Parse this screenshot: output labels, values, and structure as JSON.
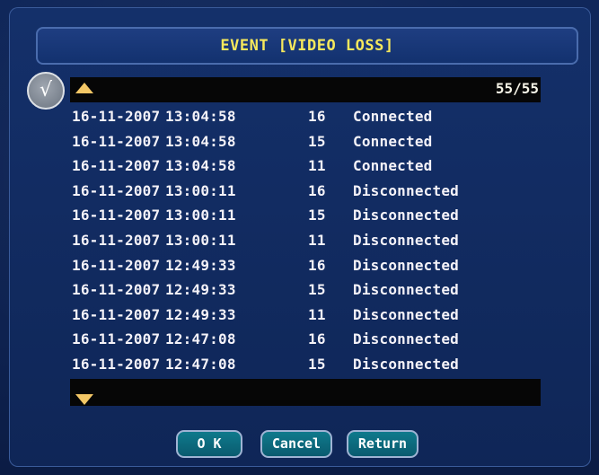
{
  "header": {
    "title": "EVENT [VIDEO LOSS]",
    "page_counter": "55/55",
    "check_mark": "√"
  },
  "events": [
    {
      "date": "16-11-2007",
      "time": "13:04:58",
      "channel": "16",
      "status": "Connected"
    },
    {
      "date": "16-11-2007",
      "time": "13:04:58",
      "channel": "15",
      "status": "Connected"
    },
    {
      "date": "16-11-2007",
      "time": "13:04:58",
      "channel": "11",
      "status": "Connected"
    },
    {
      "date": "16-11-2007",
      "time": "13:00:11",
      "channel": "16",
      "status": "Disconnected"
    },
    {
      "date": "16-11-2007",
      "time": "13:00:11",
      "channel": "15",
      "status": "Disconnected"
    },
    {
      "date": "16-11-2007",
      "time": "13:00:11",
      "channel": "11",
      "status": "Disconnected"
    },
    {
      "date": "16-11-2007",
      "time": "12:49:33",
      "channel": "16",
      "status": "Disconnected"
    },
    {
      "date": "16-11-2007",
      "time": "12:49:33",
      "channel": "15",
      "status": "Disconnected"
    },
    {
      "date": "16-11-2007",
      "time": "12:49:33",
      "channel": "11",
      "status": "Disconnected"
    },
    {
      "date": "16-11-2007",
      "time": "12:47:08",
      "channel": "16",
      "status": "Disconnected"
    },
    {
      "date": "16-11-2007",
      "time": "12:47:08",
      "channel": "15",
      "status": "Disconnected"
    }
  ],
  "buttons": {
    "ok": "O K",
    "cancel": "Cancel",
    "return": "Return"
  },
  "icons": {
    "scroll_up": "scroll-up-arrow-icon",
    "scroll_down": "scroll-down-arrow-icon",
    "check": "check-icon"
  },
  "colors": {
    "title_text": "#f6e85c",
    "arrow": "#f3c766",
    "button_bg": "#0f7a8c",
    "panel_bg": "#14306a"
  }
}
